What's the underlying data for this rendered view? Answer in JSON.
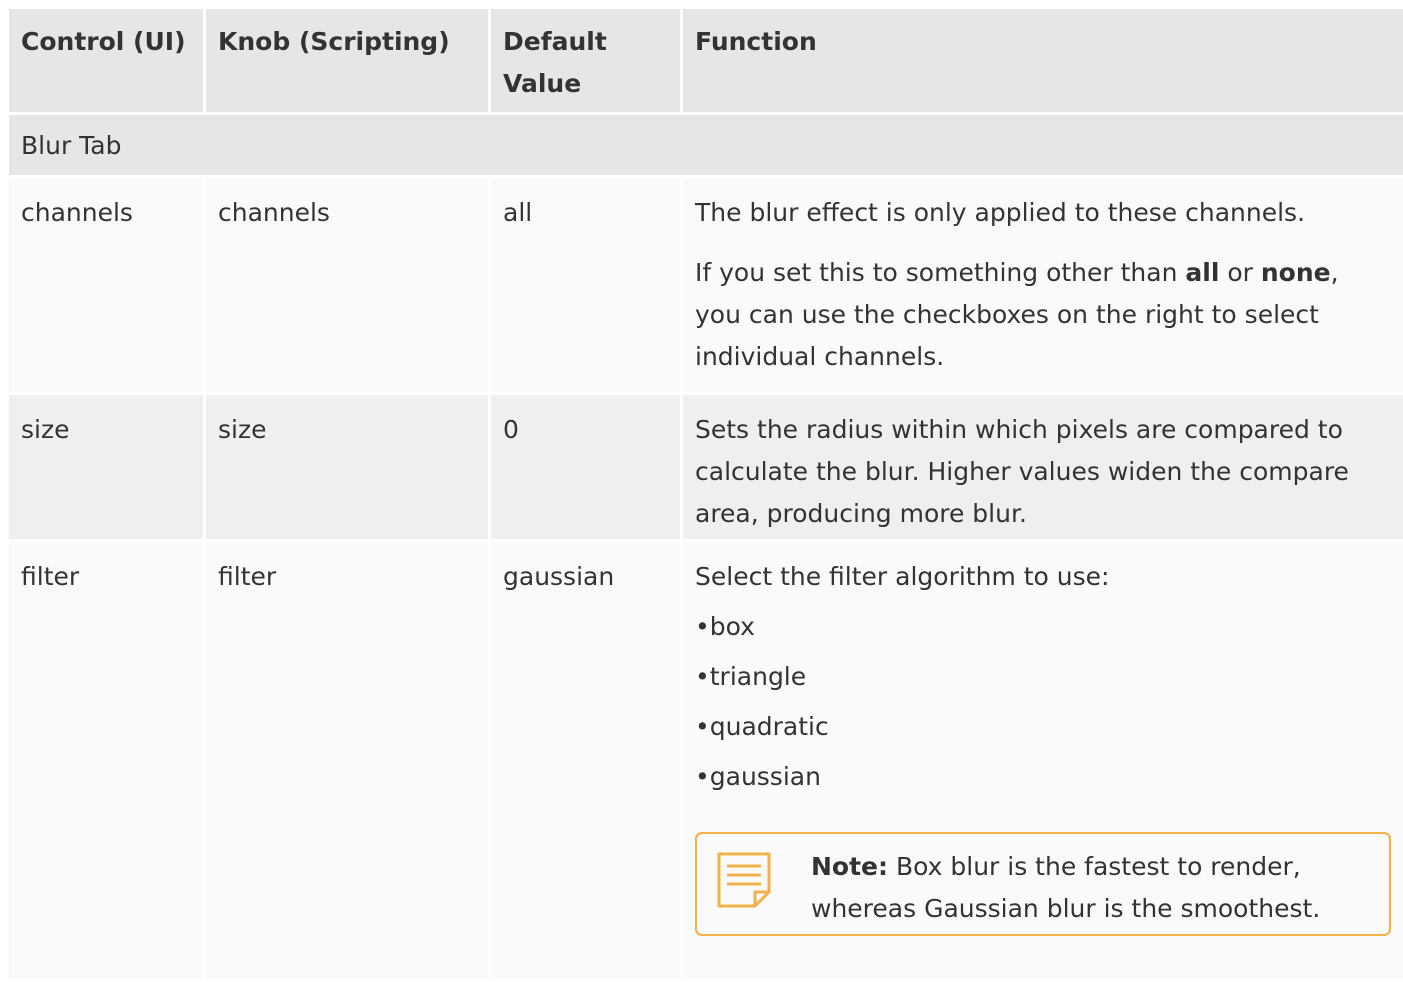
{
  "table": {
    "headers": [
      "Control (UI)",
      "Knob (Scripting)",
      "Default Value",
      "Function"
    ],
    "section": "Blur Tab",
    "rows": [
      {
        "control": "channels",
        "knob": "channels",
        "default": "all",
        "function_p1": "The blur effect is only applied to these channels.",
        "function_p2_pre": "If you set this to something other than ",
        "function_p2_b1": "all",
        "function_p2_mid": " or ",
        "function_p2_b2": "none",
        "function_p2_post": ", you can use the checkboxes on the right to select individual channels."
      },
      {
        "control": "size",
        "knob": "size",
        "default": "0",
        "function_p1": "Sets the radius within which pixels are compared to calculate the blur. Higher values widen the compare area, producing more blur."
      },
      {
        "control": "filter",
        "knob": "filter",
        "default": "gaussian",
        "function_p1": "Select the filter algorithm to use:",
        "options": [
          "box",
          "triangle",
          "quadratic",
          "gaussian"
        ],
        "note_label": "Note:",
        "note_text": " Box blur is the fastest to render, whereas Gaussian blur is the smoothest."
      }
    ]
  },
  "colors": {
    "header_bg": "#e6e6e6",
    "note_border": "#f0b04a",
    "note_icon": "#f0b04a"
  },
  "icons": {
    "note": "note-icon"
  }
}
